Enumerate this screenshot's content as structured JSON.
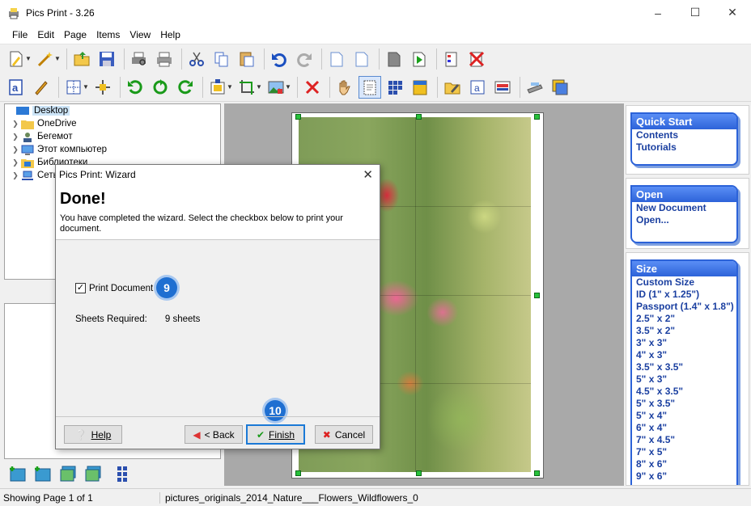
{
  "window": {
    "title": "Pics Print - 3.26"
  },
  "menu": [
    "File",
    "Edit",
    "Page",
    "Items",
    "View",
    "Help"
  ],
  "tree": [
    {
      "label": "Desktop",
      "selected": true
    },
    {
      "label": "OneDrive"
    },
    {
      "label": "Бегемот"
    },
    {
      "label": "Этот компьютер"
    },
    {
      "label": "Библиотеки"
    },
    {
      "label": "Сеть"
    }
  ],
  "dialog": {
    "title": "Pics Print: Wizard",
    "heading": "Done!",
    "description": "You have completed the wizard.  Select the checkbox below to print your document.",
    "checkbox_label": "Print Document",
    "checkbox_checked": true,
    "sheets_label": "Sheets Required:",
    "sheets_value": "9 sheets",
    "badge_checkbox": "9",
    "badge_finish": "10",
    "buttons": {
      "help": "Help",
      "back": "< Back",
      "finish": "Finish",
      "cancel": "Cancel"
    }
  },
  "right_panel": {
    "quick_start": {
      "title": "Quick Start",
      "items": [
        "Contents",
        "Tutorials"
      ]
    },
    "open": {
      "title": "Open",
      "items": [
        "New Document",
        "Open..."
      ]
    },
    "size": {
      "title": "Size",
      "items": [
        "Custom Size",
        "ID (1\" x 1.25\")",
        "Passport (1.4\" x 1.8\")",
        "2.5\" x 2\"",
        "3.5\" x 2\"",
        "3\" x 3\"",
        "4\" x 3\"",
        "3.5\" x 3.5\"",
        "5\" x 3\"",
        "4.5\" x 3.5\"",
        "5\" x 3.5\"",
        "5\" x 4\"",
        "6\" x 4\"",
        "7\" x 4.5\"",
        "7\" x 5\"",
        "8\" x 6\"",
        "9\" x 6\""
      ]
    }
  },
  "status": {
    "page": "Showing Page 1 of 1",
    "file": "pictures_originals_2014_Nature___Flowers_Wildflowers_0"
  }
}
